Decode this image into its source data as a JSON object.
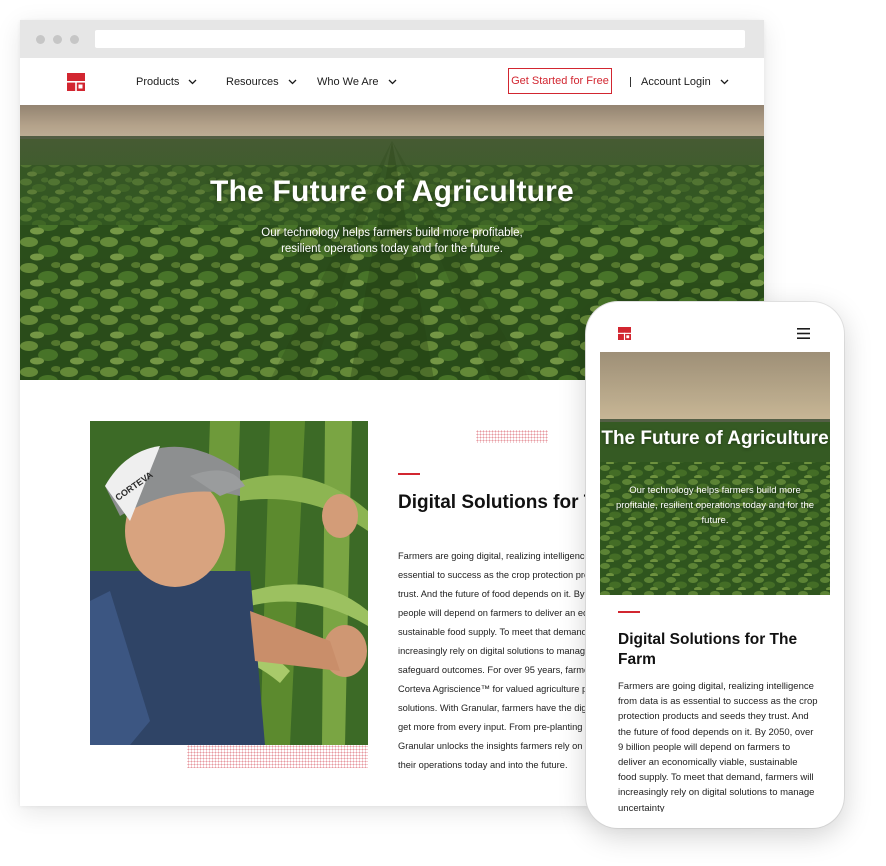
{
  "colors": {
    "brand_red": "#d22630",
    "chrome_gray": "#e6e6e6",
    "text_dark": "#1c1c1c"
  },
  "desktop": {
    "nav": {
      "logo_icon": "brand-logo-icon",
      "items": [
        {
          "label": "Products",
          "icon": "chevron-down-icon"
        },
        {
          "label": "Resources",
          "icon": "chevron-down-icon"
        },
        {
          "label": "Who We Are",
          "icon": "chevron-down-icon"
        }
      ],
      "cta_label": "Get Started for Free",
      "separator": "|",
      "account_label": "Account Login"
    },
    "hero": {
      "title": "The Future of Agriculture",
      "subtitle": "Our technology helps farmers build more profitable, resilient operations today and for the future."
    },
    "section": {
      "heading": "Digital Solutions for T",
      "body": "Farmers are going digital, realizing intelligence f essential to success as the crop protection produ trust. And the future of food depends on it. By 20 people will depend on farmers to deliver an ecor sustainable food supply. To meet that demand, f increasingly rely on digital solutions to manage u safeguard outcomes. For over 95 years, farmers Corteva Agriscience™ for valued agriculture pr solutions. With Granular, farmers have the digita get more from every input. From pre-planting to Granular unlocks the insights farmers rely on to b their operations today and into the future.",
      "body_lines": [
        "Farmers are going digital, realizing intelligence f",
        "essential to success as the crop protection produ",
        "trust. And the future of food depends on it. By 20",
        "people will depend on farmers to deliver an ecor",
        "sustainable food supply. To meet that demand, f",
        "increasingly rely on digital solutions to manage u",
        "safeguard outcomes. For over 95 years, farmers",
        "Corteva Agriscience™ for valued agriculture pr",
        "solutions. With Granular, farmers have the digita",
        "get more from every input. From pre-planting to",
        "Granular unlocks the insights farmers rely on to b",
        "their operations today and into the future."
      ],
      "cap_text": "CORTEVA"
    }
  },
  "mobile": {
    "menu_icon": "hamburger-menu-icon",
    "hero": {
      "title": "The Future of Agriculture",
      "subtitle": "Our technology helps farmers build more profitable, resilient operations today and for the future."
    },
    "section": {
      "heading": "Digital Solutions for The Farm",
      "body": "Farmers are going digital, realizing intelligence from data is as essential to success as the crop protection products and seeds they trust. And the future of food depends on it. By 2050, over 9 billion people will depend on farmers to deliver an economically viable, sustainable food supply. To meet that demand, farmers will increasingly rely on digital solutions to manage uncertainty"
    }
  }
}
